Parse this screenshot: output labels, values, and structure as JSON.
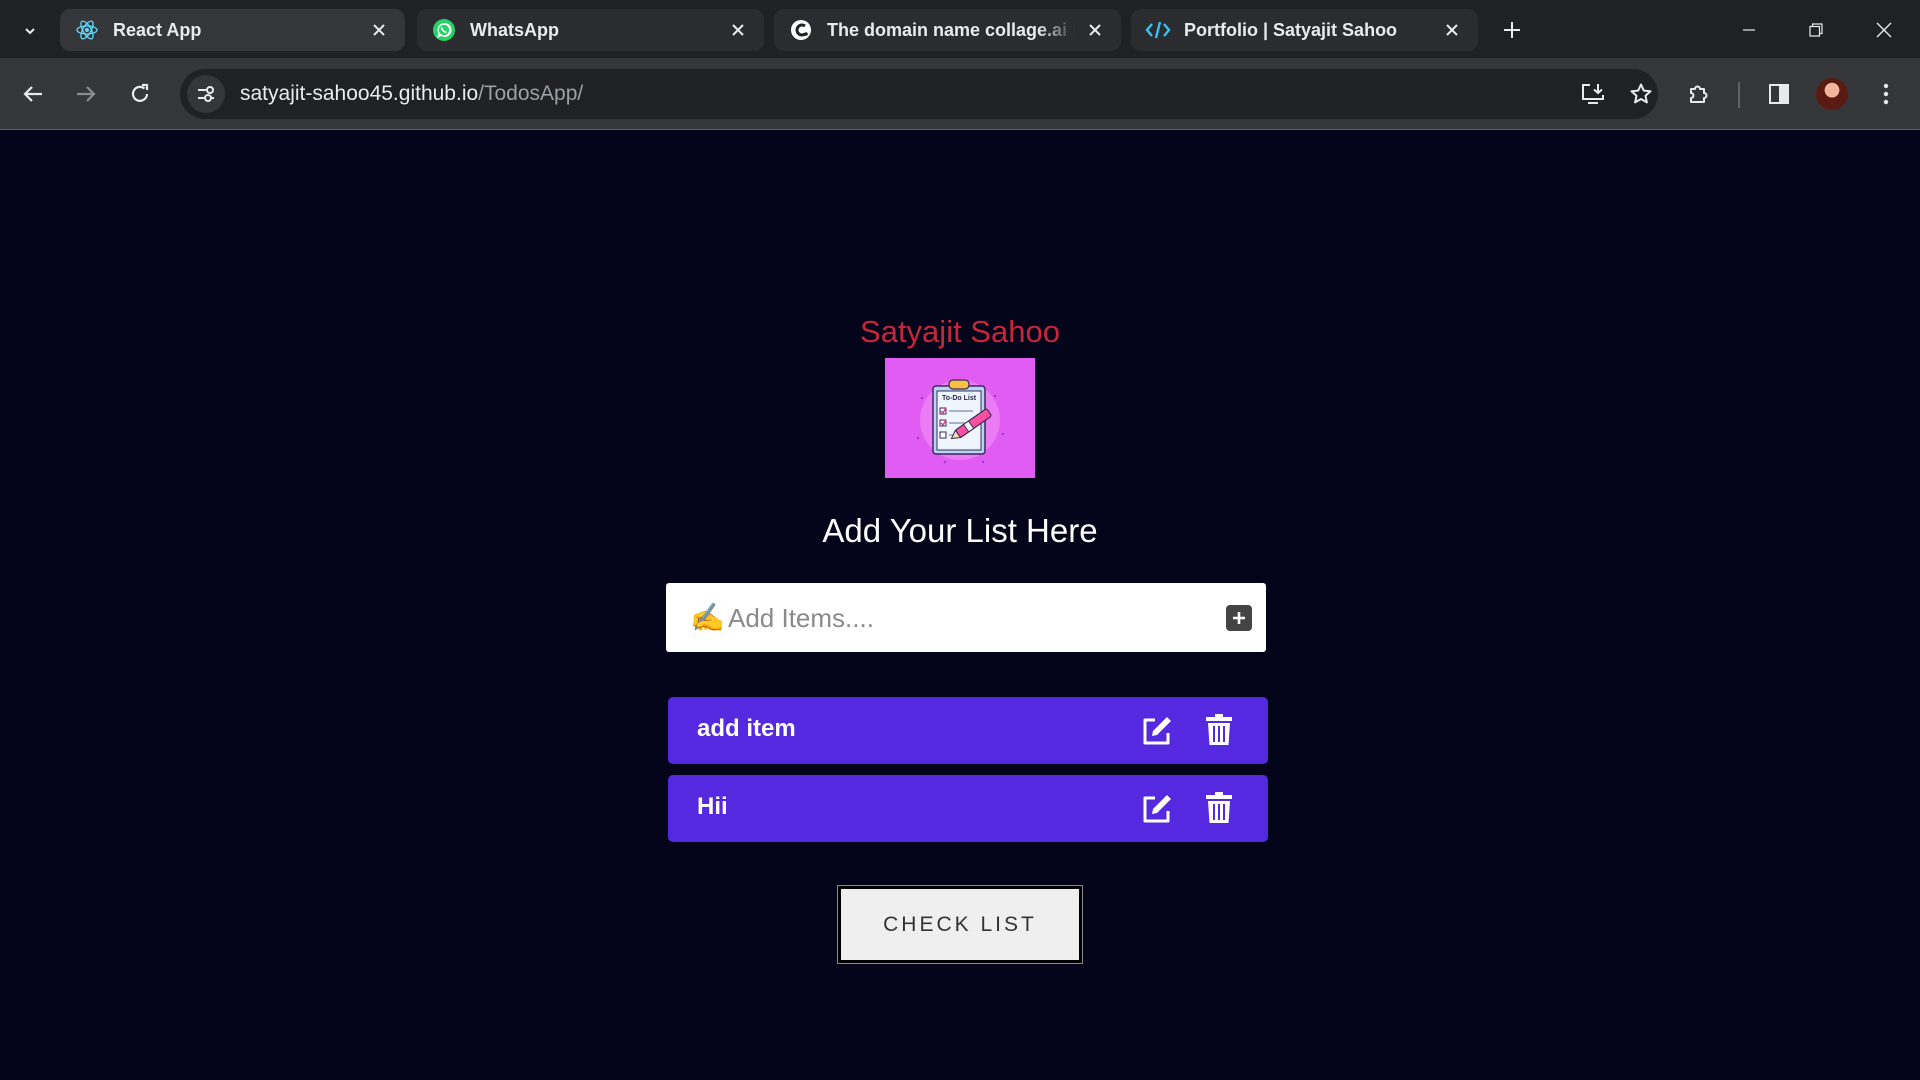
{
  "browser": {
    "tabs": [
      {
        "title": "React App",
        "icon": "react-icon",
        "active": true
      },
      {
        "title": "WhatsApp",
        "icon": "whatsapp-icon",
        "active": false
      },
      {
        "title": "The domain name collage.ai is",
        "icon": "collage-icon",
        "active": false
      },
      {
        "title": "Portfolio | Satyajit Sahoo",
        "icon": "code-icon",
        "active": false
      }
    ],
    "address": {
      "host": "satyajit-sahoo45.github.io",
      "path": "/TodosApp/"
    }
  },
  "app": {
    "author": "Satyajit Sahoo",
    "logo_text": "To-Do List",
    "heading": "Add Your List Here",
    "input_placeholder": "Add Items....",
    "input_emoji": "✍️",
    "items": [
      {
        "label": "add item"
      },
      {
        "label": "Hii"
      }
    ],
    "check_button": "CHECK LIST"
  },
  "colors": {
    "page_bg": "#04041a",
    "author": "#c9253a",
    "item_bg": "#5429e0",
    "logo_bg": "#e05cf2"
  }
}
